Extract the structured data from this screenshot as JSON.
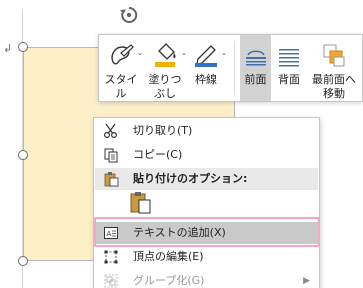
{
  "document": {
    "paragraph_mark": "↲"
  },
  "mini_toolbar": {
    "buttons": [
      {
        "label": "スタイル",
        "icon": "shape-style-icon"
      },
      {
        "label": "塗りつ\nぶし",
        "icon": "fill-bucket-icon"
      },
      {
        "label": "枠線",
        "icon": "outline-pen-icon"
      },
      {
        "label": "前面",
        "icon": "bring-forward-icon",
        "active": true
      },
      {
        "label": "背面",
        "icon": "send-backward-icon"
      },
      {
        "label": "最前面へ\n移動",
        "icon": "bring-to-front-icon"
      }
    ],
    "fill_color": "#f0b400",
    "outline_color": "#2f74c7",
    "bring_front_color": "#f0a830"
  },
  "context_menu": {
    "items": [
      {
        "label": "切り取り(T)",
        "icon": "scissors-icon"
      },
      {
        "label": "コピー(C)",
        "icon": "copy-icon"
      },
      {
        "label": "貼り付けのオプション:",
        "icon": "paste-icon",
        "header": true
      },
      {
        "label": "テキストの追加(X)",
        "icon": "text-box-icon",
        "hover": true
      },
      {
        "label": "頂点の編集(E)",
        "icon": "edit-points-icon"
      },
      {
        "label": "グループ化(G)",
        "icon": "group-icon",
        "disabled": true,
        "submenu": "▶"
      }
    ]
  },
  "colors": {
    "shape_fill": "#fdf0c9",
    "highlight": "#f4a7c3",
    "hover": "#c9c9c9"
  }
}
